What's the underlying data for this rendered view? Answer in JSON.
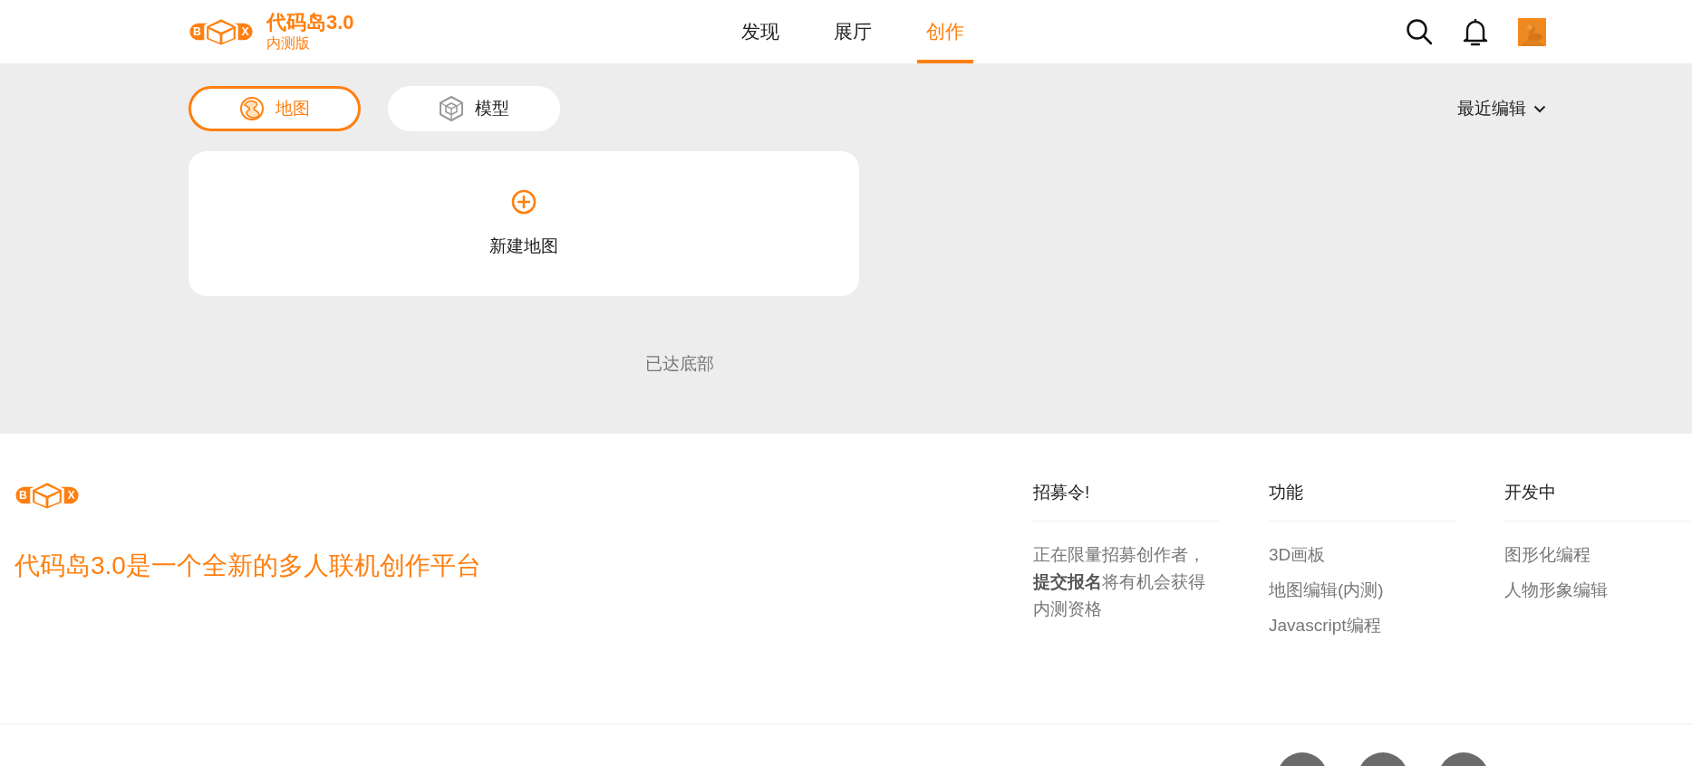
{
  "header": {
    "logo": {
      "left_letter": "B",
      "right_letter": "X"
    },
    "title": "代码岛3.0",
    "subtitle": "内测版",
    "nav": [
      {
        "label": "发现",
        "selected": false
      },
      {
        "label": "展厅",
        "selected": false
      },
      {
        "label": "创作",
        "selected": true
      }
    ]
  },
  "tabs": [
    {
      "label": "地图",
      "kind": "map",
      "selected": true
    },
    {
      "label": "模型",
      "kind": "model",
      "selected": false
    }
  ],
  "sort": {
    "label": "最近编辑"
  },
  "new_card": {
    "label": "新建地图"
  },
  "end_note": "已达底部",
  "footer": {
    "logo": {
      "left_letter": "B",
      "right_letter": "X"
    },
    "slogan": "代码岛3.0是一个全新的多人联机创作平台",
    "columns": [
      {
        "heading": "招募令!",
        "items": [
          "正在限量招募创作者，**提交报名**将有机会获得内测资格"
        ]
      },
      {
        "heading": "功能",
        "items": [
          "3D画板",
          "地图编辑(内测)",
          "Javascript编程"
        ]
      },
      {
        "heading": "开发中",
        "items": [
          "图形化编程",
          "人物形象编辑"
        ]
      }
    ]
  }
}
